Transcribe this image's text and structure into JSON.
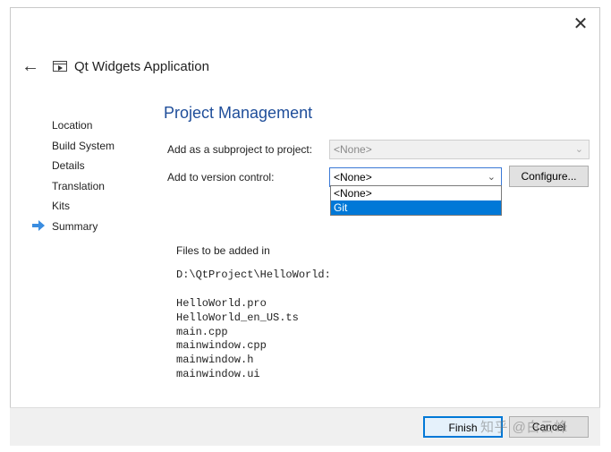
{
  "window": {
    "close_label": "✕"
  },
  "header": {
    "back_label": "←",
    "title": "Qt Widgets Application"
  },
  "steps": [
    {
      "label": "Location"
    },
    {
      "label": "Build System"
    },
    {
      "label": "Details"
    },
    {
      "label": "Translation"
    },
    {
      "label": "Kits"
    },
    {
      "label": "Summary",
      "current": true
    }
  ],
  "page": {
    "title": "Project Management",
    "subproject": {
      "label": "Add as a subproject to project:",
      "value": "<None>",
      "enabled": false
    },
    "version_control": {
      "label": "Add to version control:",
      "value": "<None>",
      "configure_label": "Configure...",
      "options": [
        "<None>",
        "Git"
      ],
      "highlighted_option": "Git"
    },
    "files": {
      "heading": "Files to be added in",
      "path": "D:\\QtProject\\HelloWorld:",
      "list": [
        "HelloWorld.pro",
        "HelloWorld_en_US.ts",
        "main.cpp",
        "mainwindow.cpp",
        "mainwindow.h",
        "mainwindow.ui"
      ]
    }
  },
  "footer": {
    "finish_label": "Finish",
    "cancel_label": "Cancel"
  },
  "watermark": "知乎 @白云峰",
  "colors": {
    "accent": "#0078d7",
    "title": "#1f4e9a",
    "step_arrow": "#3a8de0"
  }
}
